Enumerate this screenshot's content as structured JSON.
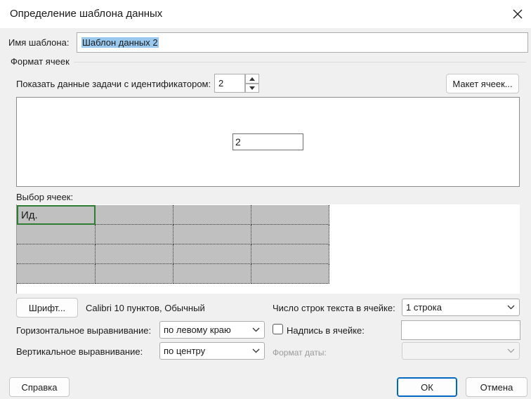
{
  "dialog": {
    "title": "Определение шаблона данных"
  },
  "template_name": {
    "label": "Имя шаблона:",
    "value": "Шаблон данных 2"
  },
  "cell_format": {
    "group_label": "Формат ячеек",
    "show_task_label": "Показать данные задачи с идентификатором:",
    "task_id_value": "2",
    "cell_layout_button": "Макет ячеек...",
    "preview_cell_value": "2"
  },
  "cell_selection": {
    "label": "Выбор ячеек:",
    "first_cell_text": "Ид."
  },
  "font": {
    "button": "Шрифт...",
    "description": "Calibri 10 пунктов, Обычный"
  },
  "rows": {
    "label": "Число строк текста в ячейке:",
    "value": "1 строка"
  },
  "horizontal_align": {
    "label": "Горизонтальное выравнивание:",
    "value": "по левому краю"
  },
  "vertical_align": {
    "label": "Вертикальное выравнивание:",
    "value": "по центру"
  },
  "caption": {
    "label": "Надпись в ячейке:",
    "checked": false,
    "value": ""
  },
  "date_format": {
    "label": "Формат даты:",
    "value": ""
  },
  "footer": {
    "help_button": "Справка",
    "ok_button": "ОК",
    "cancel_button": "Отмена"
  }
}
